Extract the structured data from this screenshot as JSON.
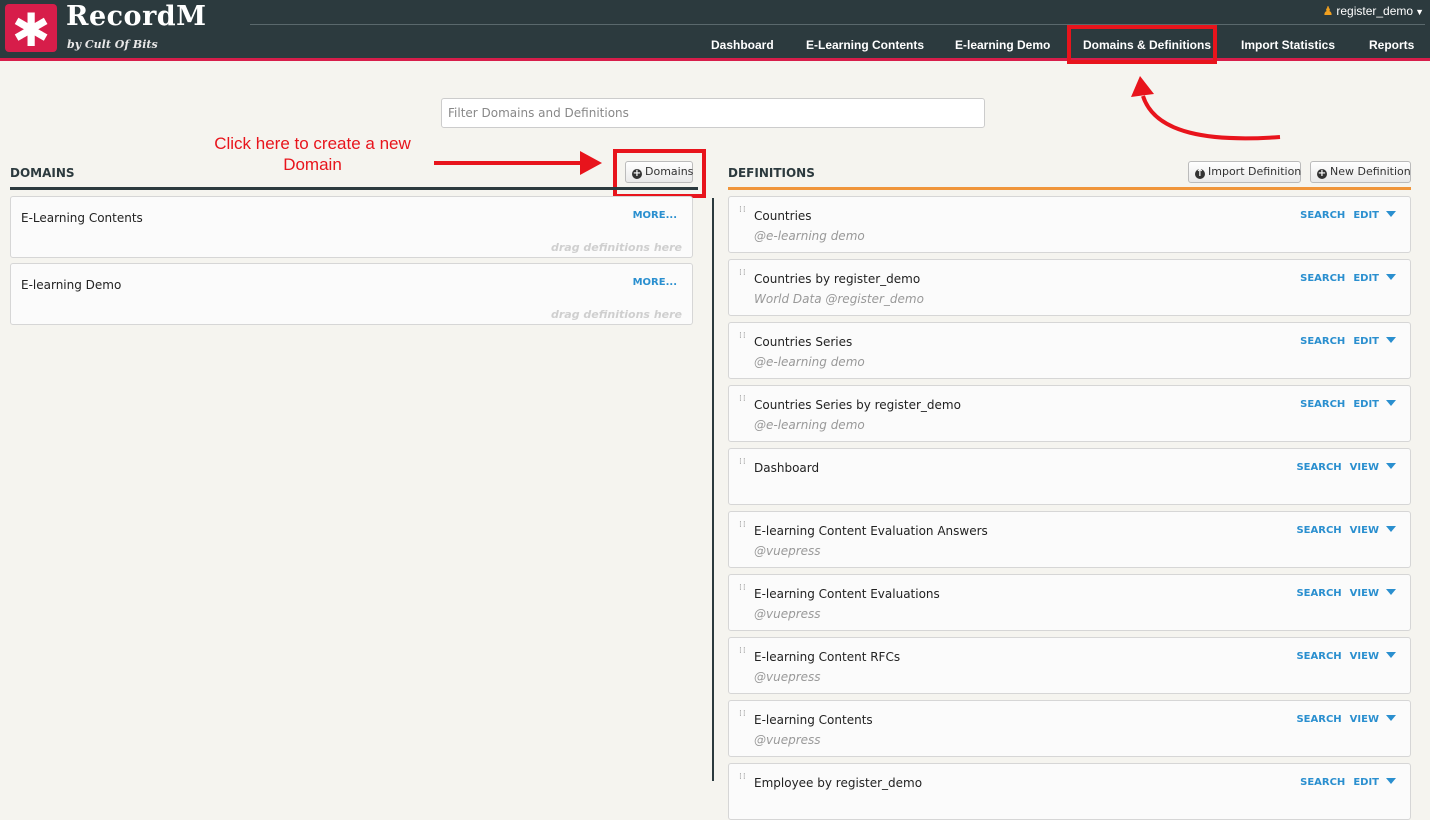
{
  "app": {
    "title": "RecordM",
    "subtitle": "by Cult Of Bits",
    "logo_glyph": "✱"
  },
  "user": {
    "name": "register_demo"
  },
  "nav": [
    {
      "label": "Dashboard"
    },
    {
      "label": "E-Learning Contents"
    },
    {
      "label": "E-learning Demo"
    },
    {
      "label": "Domains & Definitions",
      "active": true
    },
    {
      "label": "Import Statistics"
    },
    {
      "label": "Reports"
    }
  ],
  "filter": {
    "placeholder": "Filter Domains and Definitions",
    "value": ""
  },
  "domains": {
    "title": "DOMAINS",
    "add_button": "Domains",
    "more_label": "MORE...",
    "drag_hint": "drag definitions here",
    "items": [
      {
        "name": "E-Learning Contents"
      },
      {
        "name": "E-learning Demo"
      }
    ]
  },
  "definitions": {
    "title": "DEFINITIONS",
    "import_button": "Import Definition",
    "new_button": "New Definition",
    "items": [
      {
        "name": "Countries",
        "sub": "@e-learning demo",
        "action1": "SEARCH",
        "action2": "EDIT"
      },
      {
        "name": "Countries by register_demo",
        "sub": "World Data @register_demo",
        "action1": "SEARCH",
        "action2": "EDIT"
      },
      {
        "name": "Countries Series",
        "sub": "@e-learning demo",
        "action1": "SEARCH",
        "action2": "EDIT"
      },
      {
        "name": "Countries Series by register_demo",
        "sub": "@e-learning demo",
        "action1": "SEARCH",
        "action2": "EDIT"
      },
      {
        "name": "Dashboard",
        "sub": "",
        "action1": "SEARCH",
        "action2": "VIEW"
      },
      {
        "name": "E-learning Content Evaluation Answers",
        "sub": "@vuepress",
        "action1": "SEARCH",
        "action2": "VIEW"
      },
      {
        "name": "E-learning Content Evaluations",
        "sub": "@vuepress",
        "action1": "SEARCH",
        "action2": "VIEW"
      },
      {
        "name": "E-learning Content RFCs",
        "sub": "@vuepress",
        "action1": "SEARCH",
        "action2": "VIEW"
      },
      {
        "name": "E-learning Contents",
        "sub": "@vuepress",
        "action1": "SEARCH",
        "action2": "VIEW"
      },
      {
        "name": "Employee by register_demo",
        "sub": "",
        "action1": "SEARCH",
        "action2": "EDIT"
      }
    ]
  },
  "annotation": {
    "text": "Click here to create a new Domain"
  },
  "colors": {
    "header": "#2c3a3e",
    "brand": "#d71d4a",
    "annotation": "#e8141c",
    "link": "#2a8fcf",
    "definitions_rule": "#f0953a"
  }
}
